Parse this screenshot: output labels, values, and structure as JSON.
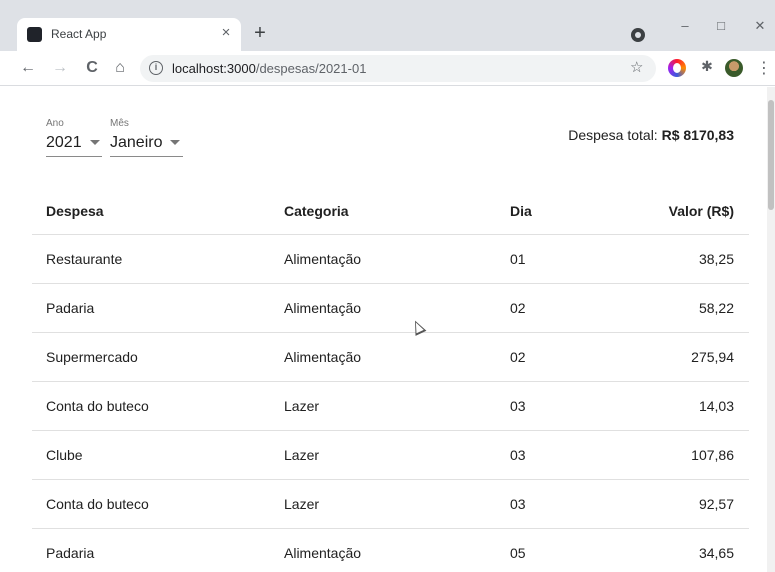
{
  "browser": {
    "tab_title": "React App",
    "tab_close": "×",
    "new_tab": "+",
    "window_controls": {
      "minimize": "–",
      "maximize": "□",
      "close": "✕"
    },
    "nav": {
      "back": "←",
      "forward": "→",
      "reload": "C",
      "home": "⌂"
    },
    "url_host": "localhost:3000",
    "url_path": "/despesas/2021-01",
    "info_glyph": "i",
    "star_glyph": "☆",
    "puzzle_glyph": "✱",
    "menu_glyph": "⋮"
  },
  "filters": {
    "ano": {
      "label": "Ano",
      "value": "2021"
    },
    "mes": {
      "label": "Mês",
      "value": "Janeiro"
    }
  },
  "summary": {
    "label": "Despesa total:",
    "value": "R$ 8170,83"
  },
  "table": {
    "headers": [
      "Despesa",
      "Categoria",
      "Dia",
      "Valor (R$)"
    ],
    "rows": [
      [
        "Restaurante",
        "Alimentação",
        "01",
        "38,25"
      ],
      [
        "Padaria",
        "Alimentação",
        "02",
        "58,22"
      ],
      [
        "Supermercado",
        "Alimentação",
        "02",
        "275,94"
      ],
      [
        "Conta do buteco",
        "Lazer",
        "03",
        "14,03"
      ],
      [
        "Clube",
        "Lazer",
        "03",
        "107,86"
      ],
      [
        "Conta do buteco",
        "Lazer",
        "03",
        "92,57"
      ],
      [
        "Padaria",
        "Alimentação",
        "05",
        "34,65"
      ]
    ]
  }
}
